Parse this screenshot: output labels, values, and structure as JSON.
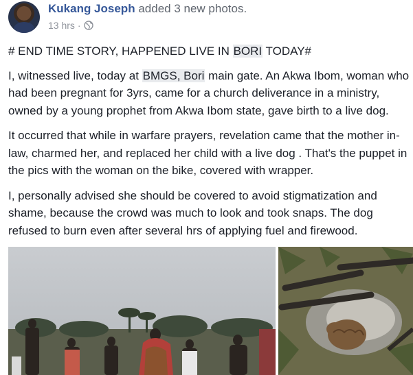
{
  "post": {
    "author": "Kukang Joseph",
    "action": "added 3 new photos.",
    "timestamp": "13 hrs",
    "separator": "·",
    "privacy_icon": "globe-icon",
    "title": {
      "prefix": "# END TIME STORY, HAPPENED LIVE IN ",
      "highlight": "BORI",
      "suffix": " TODAY#"
    },
    "paragraph1": {
      "prefix": "I, witnessed live, today at ",
      "highlight": "BMGS, Bori",
      "suffix": " main gate. An Akwa Ibom, woman who had been pregnant for 3yrs, came for a church deliverance in a ministry, owned by a young prophet from Akwa Ibom state, gave birth to a live dog."
    },
    "paragraph2": "It occurred that while in warfare prayers, revelation came that the mother in-law, charmed her, and replaced her child with a live dog . That's the puppet in the pics with the woman on the bike, covered with wrapper.",
    "paragraph3": "I, personally advised she should be covered to avoid stigmatization and shame, because the crowd was much to look and took snaps. The dog refused to burn even after several hrs of applying fuel and firewood.",
    "photos": [
      {
        "name": "crowd-photo"
      },
      {
        "name": "burnt-dog-photo"
      }
    ]
  },
  "colors": {
    "link": "#365899",
    "text": "#1d2129",
    "meta": "#90949c",
    "highlight_bg": "#e9ebee"
  }
}
